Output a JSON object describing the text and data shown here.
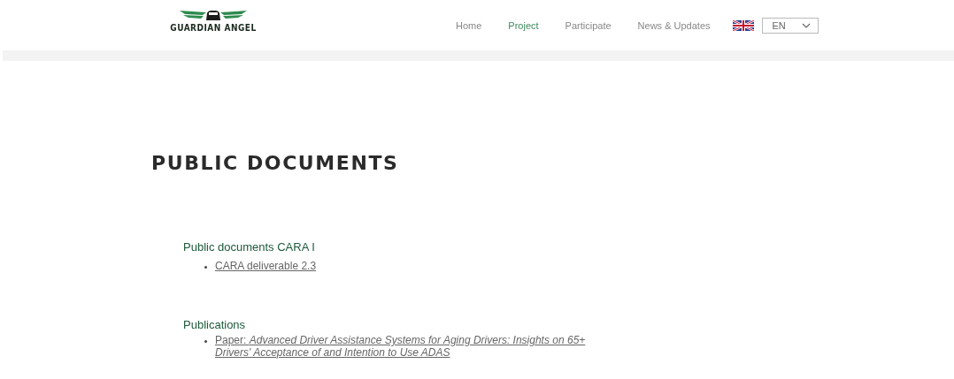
{
  "logo": {
    "text": "GUARDIAN ANGEL"
  },
  "nav": [
    {
      "label": "Home",
      "selected": false
    },
    {
      "label": "Project",
      "selected": true
    },
    {
      "label": "Participate",
      "selected": false
    },
    {
      "label": "News & Updates",
      "selected": false
    }
  ],
  "language": {
    "value": "EN"
  },
  "page_title": "PUBLIC DOCUMENTS",
  "sections": [
    {
      "heading": "Public documents CARA I",
      "links": [
        "CARA deliverable 2.3 "
      ]
    },
    {
      "heading": "Publications",
      "links": [
        "Paper: *Advanced Driver Assistance Systems for Aging Drivers: Insights on 65+ Drivers' Acceptance of and Intention to Use ADAS*"
      ]
    }
  ]
}
